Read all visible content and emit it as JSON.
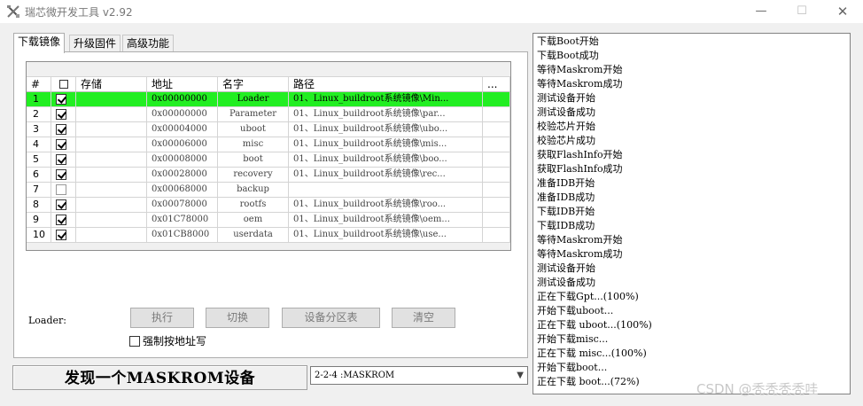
{
  "window": {
    "title": "瑞芯微开发工具 v2.92",
    "min_glyph": "—",
    "max_glyph": "☐",
    "close_glyph": "✕"
  },
  "tabs": [
    "下载镜像",
    "升级固件",
    "高级功能"
  ],
  "table": {
    "headers": {
      "num": "#",
      "check": "",
      "storage": "存储",
      "address": "地址",
      "name": "名字",
      "path": "路径",
      "more": "..."
    },
    "rows": [
      {
        "num": "1",
        "checked": true,
        "storage": "",
        "address": "0x00000000",
        "name": "Loader",
        "path": "01、Linux_buildroot系统镜像\\Min...",
        "selected": true
      },
      {
        "num": "2",
        "checked": true,
        "storage": "",
        "address": "0x00000000",
        "name": "Parameter",
        "path": "01、Linux_buildroot系统镜像\\par...",
        "selected": false
      },
      {
        "num": "3",
        "checked": true,
        "storage": "",
        "address": "0x00004000",
        "name": "uboot",
        "path": "01、Linux_buildroot系统镜像\\ubo...",
        "selected": false
      },
      {
        "num": "4",
        "checked": true,
        "storage": "",
        "address": "0x00006000",
        "name": "misc",
        "path": "01、Linux_buildroot系统镜像\\mis...",
        "selected": false
      },
      {
        "num": "5",
        "checked": true,
        "storage": "",
        "address": "0x00008000",
        "name": "boot",
        "path": "01、Linux_buildroot系统镜像\\boo...",
        "selected": false
      },
      {
        "num": "6",
        "checked": true,
        "storage": "",
        "address": "0x00028000",
        "name": "recovery",
        "path": "01、Linux_buildroot系统镜像\\rec...",
        "selected": false
      },
      {
        "num": "7",
        "checked": false,
        "storage": "",
        "address": "0x00068000",
        "name": "backup",
        "path": "",
        "selected": false
      },
      {
        "num": "8",
        "checked": true,
        "storage": "",
        "address": "0x00078000",
        "name": "rootfs",
        "path": "01、Linux_buildroot系统镜像\\roo...",
        "selected": false
      },
      {
        "num": "9",
        "checked": true,
        "storage": "",
        "address": "0x01C78000",
        "name": "oem",
        "path": "01、Linux_buildroot系统镜像\\oem...",
        "selected": false
      },
      {
        "num": "10",
        "checked": true,
        "storage": "",
        "address": "0x01CB8000",
        "name": "userdata",
        "path": "01、Linux_buildroot系统镜像\\use...",
        "selected": false
      }
    ]
  },
  "loader_label": "Loader:",
  "buttons": {
    "execute": "执行",
    "switch": "切换",
    "partition_table": "设备分区表",
    "clear": "清空"
  },
  "force_address_write": {
    "label": "强制按地址写",
    "checked": false
  },
  "status_message": "发现一个MASKROM设备",
  "device_select": {
    "value": "2-2-4 :MASKROM"
  },
  "log_lines": [
    "下载Boot开始",
    "下载Boot成功",
    "等待Maskrom开始",
    "等待Maskrom成功",
    "测试设备开始",
    "测试设备成功",
    "校验芯片开始",
    "校验芯片成功",
    "获取FlashInfo开始",
    "获取FlashInfo成功",
    "准备IDB开始",
    "准备IDB成功",
    "下载IDB开始",
    "下载IDB成功",
    "等待Maskrom开始",
    "等待Maskrom成功",
    "测试设备开始",
    "测试设备成功",
    "正在下载Gpt...(100%)",
    "开始下载uboot...",
    "正在下载 uboot...(100%)",
    "开始下载misc...",
    "正在下载 misc...(100%)",
    "开始下载boot...",
    "正在下载 boot...(72%)"
  ],
  "watermark": "CSDN @秃秃秃秃哇",
  "colors": {
    "selected_row": "#22ee22",
    "window_bg": "#f0f0f0"
  }
}
